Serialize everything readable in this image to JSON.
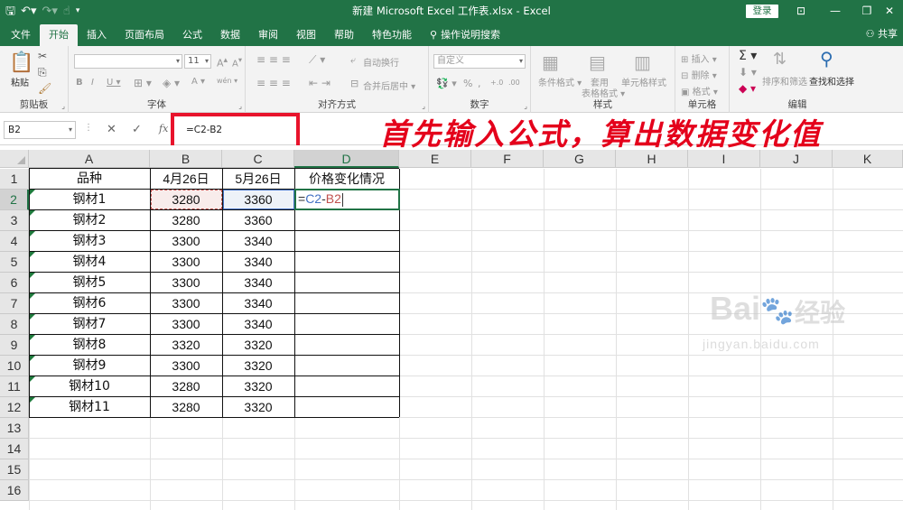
{
  "titlebar": {
    "title": "新建 Microsoft Excel 工作表.xlsx  -  Excel",
    "login": "登录",
    "qat_icons": [
      "save-icon",
      "undo-icon",
      "redo-icon",
      "touch-mode-icon",
      "customize-qat-icon"
    ],
    "window_controls": [
      "ribbon-options-icon",
      "minimize-icon",
      "restore-icon",
      "close-icon"
    ]
  },
  "tabs": [
    "文件",
    "开始",
    "插入",
    "页面布局",
    "公式",
    "数据",
    "审阅",
    "视图",
    "帮助",
    "特色功能"
  ],
  "active_tab": "开始",
  "tell_me": "操作说明搜索",
  "share": "共享",
  "ribbon": {
    "clipboard": {
      "label": "剪贴板",
      "paste": "粘贴"
    },
    "font": {
      "label": "字体",
      "size": "11"
    },
    "alignment": {
      "label": "对齐方式",
      "wrap": "自动换行",
      "merge": "合并后居中"
    },
    "number": {
      "label": "数字",
      "format": "自定义"
    },
    "styles": {
      "label": "样式",
      "cond": "条件格式",
      "table": "套用",
      "table2": "表格格式",
      "cell": "单元格样式"
    },
    "cells": {
      "label": "单元格",
      "insert": "插入",
      "delete": "删除",
      "format": "格式"
    },
    "editing": {
      "label": "编辑",
      "sort": "排序和筛选",
      "find": "查找和选择"
    }
  },
  "formula_bar": {
    "name_box": "B2",
    "formula": "=C2-B2"
  },
  "columns": [
    "A",
    "B",
    "C",
    "D",
    "E",
    "F",
    "G",
    "H",
    "I",
    "J",
    "K"
  ],
  "rows": [
    "1",
    "2",
    "3",
    "4",
    "5",
    "6",
    "7",
    "8",
    "9",
    "10",
    "11",
    "12",
    "13",
    "14",
    "15",
    "16"
  ],
  "header_row": [
    "品种",
    "4月26日",
    "5月26日",
    "价格变化情况"
  ],
  "table": [
    [
      "钢材1",
      "3280",
      "3360"
    ],
    [
      "钢材2",
      "3280",
      "3360"
    ],
    [
      "钢材3",
      "3300",
      "3340"
    ],
    [
      "钢材4",
      "3300",
      "3340"
    ],
    [
      "钢材5",
      "3300",
      "3340"
    ],
    [
      "钢材6",
      "3300",
      "3340"
    ],
    [
      "钢材7",
      "3300",
      "3340"
    ],
    [
      "钢材8",
      "3320",
      "3320"
    ],
    [
      "钢材9",
      "3300",
      "3320"
    ],
    [
      "钢材10",
      "3280",
      "3320"
    ],
    [
      "钢材11",
      "3280",
      "3320"
    ]
  ],
  "editing_cell": {
    "eq": "=",
    "ref1": "C2",
    "op": "-",
    "ref2": "B2"
  },
  "annotation": "首先输入公式，算出数据变化值",
  "watermark": {
    "logo": "Bai",
    "logo_cn": "经验",
    "url": "jingyan.baidu.com"
  },
  "colors": {
    "excel_green": "#217346",
    "annotation_red": "#e4001b",
    "ref_blue": "#4472c4",
    "ref_red": "#c0504d"
  }
}
